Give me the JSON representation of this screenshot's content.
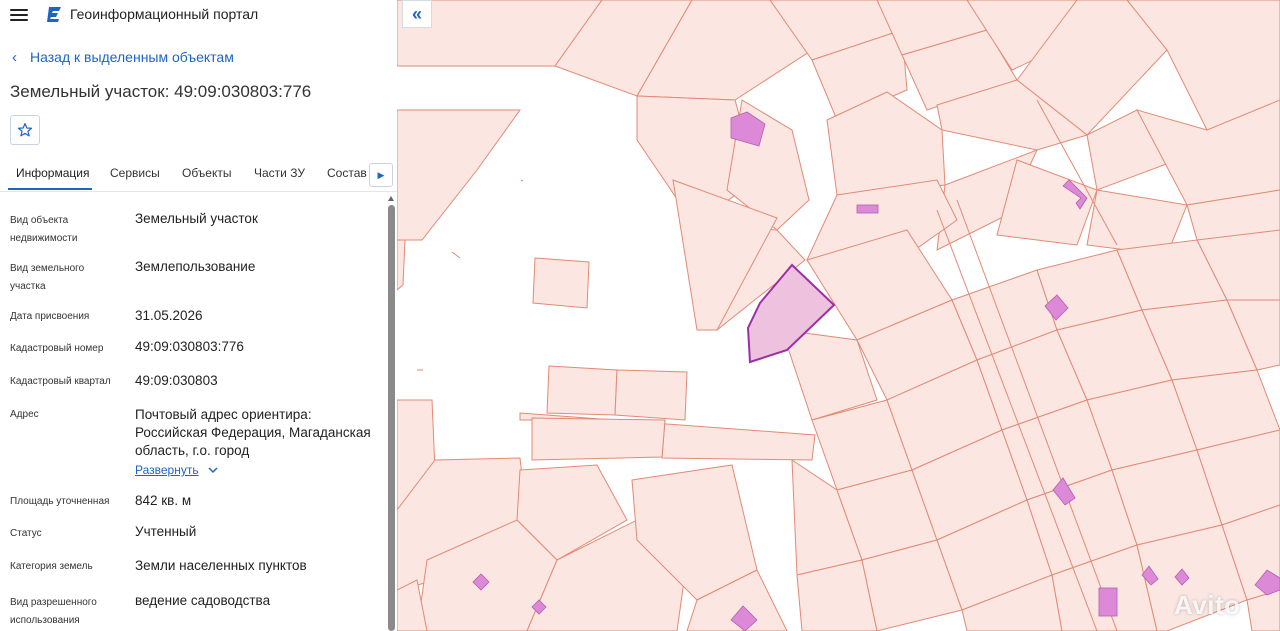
{
  "header": {
    "app_title": "Геоинформационный портал"
  },
  "nav": {
    "back_label": "Назад к выделенным объектам",
    "back_chevron": "‹"
  },
  "object": {
    "title": "Земельный участок: 49:09:030803:776"
  },
  "tabs": [
    {
      "label": "Информация",
      "active": true
    },
    {
      "label": "Сервисы",
      "active": false
    },
    {
      "label": "Объекты",
      "active": false
    },
    {
      "label": "Части ЗУ",
      "active": false
    },
    {
      "label": "Состав",
      "active": false
    }
  ],
  "properties": [
    {
      "label": "Вид объекта недвижимости",
      "value": "Земельный участок"
    },
    {
      "label": "Вид земельного участка",
      "value": "Землепользование"
    },
    {
      "label": "Дата присвоения",
      "value": "31.05.2026"
    },
    {
      "label": "Кадастровый номер",
      "value": "49:09:030803:776"
    },
    {
      "label": "Кадастровый квартал",
      "value": "49:09:030803"
    },
    {
      "label": "Адрес",
      "value": "Почтовый адрес ориентира: Российская Федерация, Магаданская область, г.о. город"
    },
    {
      "label": "Площадь уточненная",
      "value": "842 кв. м"
    },
    {
      "label": "Статус",
      "value": "Учтенный"
    },
    {
      "label": "Категория земель",
      "value": "Земли населенных пунктов"
    },
    {
      "label": "Вид разрешенного использования",
      "value": "ведение садоводства"
    }
  ],
  "address_expand_label": "Развернуть",
  "map": {
    "collapse_glyph": "«",
    "watermark": "Avito"
  },
  "colors": {
    "accent": "#1f63c7",
    "parcel_fill": "#fbe6e1",
    "parcel_stroke": "#e28a75",
    "building_fill": "#dc8ad7",
    "selected_stroke": "#9c2fa6"
  },
  "icons": [
    "menu-icon",
    "portal-logo-icon",
    "chevron-left-icon",
    "star-icon",
    "chevron-right-icon",
    "chevron-down-icon",
    "double-chevron-left-icon"
  ]
}
